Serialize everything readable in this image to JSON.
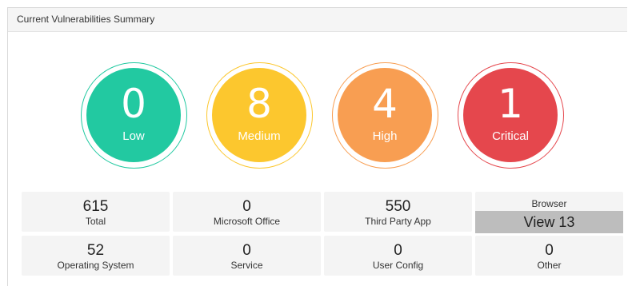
{
  "panel": {
    "title": "Current Vulnerabilities Summary"
  },
  "severity": [
    {
      "id": "low",
      "count": "0",
      "label": "Low",
      "color": "#22c9a1",
      "ring": "#22c9a1"
    },
    {
      "id": "medium",
      "count": "8",
      "label": "Medium",
      "color": "#fcc72e",
      "ring": "#fcc72e"
    },
    {
      "id": "high",
      "count": "4",
      "label": "High",
      "color": "#f89e52",
      "ring": "#f89e52"
    },
    {
      "id": "critical",
      "count": "1",
      "label": "Critical",
      "color": "#e5474d",
      "ring": "#e5474d"
    }
  ],
  "stats": {
    "total": {
      "value": "615",
      "label": "Total"
    },
    "microsoft_office": {
      "value": "0",
      "label": "Microsoft Office"
    },
    "third_party_app": {
      "value": "550",
      "label": "Third Party App"
    },
    "browser": {
      "label": "Browser",
      "view_label": "View 13"
    },
    "operating_system": {
      "value": "52",
      "label": "Operating System"
    },
    "service": {
      "value": "0",
      "label": "Service"
    },
    "user_config": {
      "value": "0",
      "label": "User Config"
    },
    "other": {
      "value": "0",
      "label": "Other"
    }
  }
}
